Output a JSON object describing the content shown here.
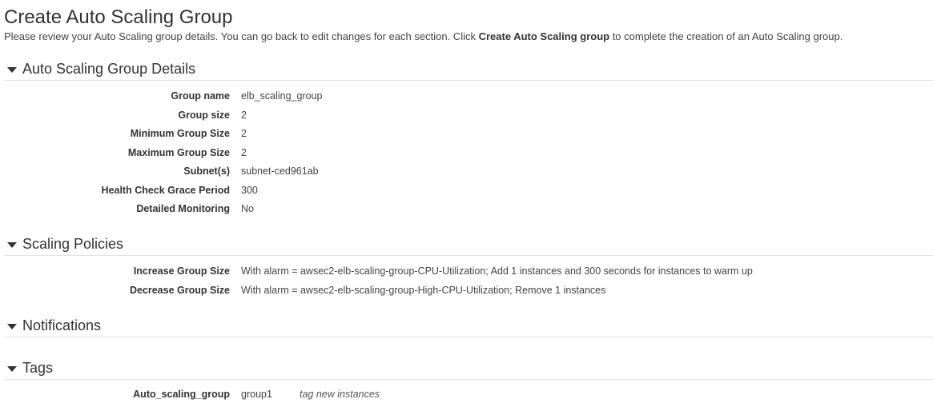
{
  "page": {
    "title": "Create Auto Scaling Group",
    "intro_before": "Please review your Auto Scaling group details. You can go back to edit changes for each section. Click ",
    "intro_bold": "Create Auto Scaling group",
    "intro_after": " to complete the creation of an Auto Scaling group."
  },
  "details": {
    "title": "Auto Scaling Group Details",
    "rows": [
      {
        "label": "Group name",
        "value": "elb_scaling_group"
      },
      {
        "label": "Group size",
        "value": "2"
      },
      {
        "label": "Minimum Group Size",
        "value": "2"
      },
      {
        "label": "Maximum Group Size",
        "value": "2"
      },
      {
        "label": "Subnet(s)",
        "value": "subnet-ced961ab"
      },
      {
        "label": "Health Check Grace Period",
        "value": "300"
      },
      {
        "label": "Detailed Monitoring",
        "value": "No"
      }
    ]
  },
  "policies": {
    "title": "Scaling Policies",
    "rows": [
      {
        "label": "Increase Group Size",
        "value": "With alarm = awsec2-elb-scaling-group-CPU-Utilization; Add 1 instances and 300 seconds for instances to warm up"
      },
      {
        "label": "Decrease Group Size",
        "value": "With alarm = awsec2-elb-scaling-group-High-CPU-Utilization; Remove 1 instances"
      }
    ]
  },
  "notifications": {
    "title": "Notifications"
  },
  "tags": {
    "title": "Tags",
    "rows": [
      {
        "key": "Auto_scaling_group",
        "value": "group1",
        "note": "tag new instances"
      }
    ]
  },
  "icons": {
    "section_toggle": "caret-down-icon"
  }
}
